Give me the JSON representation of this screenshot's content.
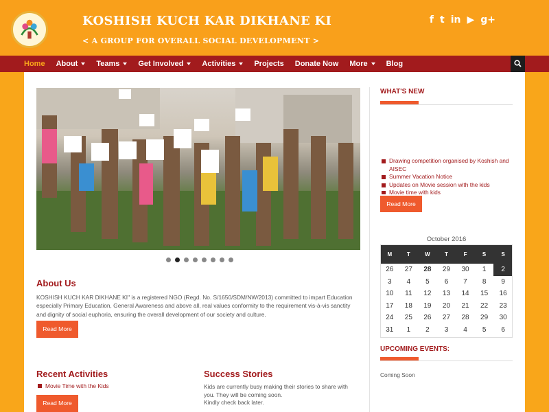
{
  "header": {
    "title": "KOSHISH KUCH KAR DIKHANE KI",
    "tagline": "< A GROUP FOR OVERALL SOCIAL DEVELOPMENT >",
    "logo_text": "KOSHISH KUCH KAR DIKHANE KI",
    "social": [
      {
        "icon": "facebook-icon",
        "glyph": "f"
      },
      {
        "icon": "twitter-icon",
        "glyph": "t"
      },
      {
        "icon": "linkedin-icon",
        "glyph": "in"
      },
      {
        "icon": "youtube-icon",
        "glyph": "▶"
      },
      {
        "icon": "googleplus-icon",
        "glyph": "g+"
      }
    ]
  },
  "nav": {
    "items": [
      {
        "label": "Home",
        "active": true,
        "dropdown": false
      },
      {
        "label": "About",
        "dropdown": true
      },
      {
        "label": "Teams",
        "dropdown": true
      },
      {
        "label": "Get Involved",
        "dropdown": true
      },
      {
        "label": "Activities",
        "dropdown": true
      },
      {
        "label": "Projects",
        "dropdown": false
      },
      {
        "label": "Donate Now",
        "dropdown": false
      },
      {
        "label": "More",
        "dropdown": true
      },
      {
        "label": "Blog",
        "dropdown": false
      }
    ]
  },
  "slider": {
    "dot_count": 8,
    "active_index": 1
  },
  "about": {
    "heading": "About Us",
    "text": "KOSHISH KUCH KAR DIKHANE KI\" is a registered NGO (Regd. No. S/1650/SDM/NW/2013) committed to impart Education especially Primary Education, General Awareness and above all, real values conformity to the requirement vis-à-vis sanctity and dignity of social euphoria, ensuring the overall development of our society and culture.",
    "button": "Read More"
  },
  "recent": {
    "heading": "Recent Activities",
    "items": [
      "Movie Time with the Kids"
    ],
    "button": "Read More"
  },
  "success": {
    "heading": "Success Stories",
    "lines": [
      "Kids are currently busy making their stories to share with",
      "you. They will be coming soon.",
      "Kindly check back later."
    ]
  },
  "whats_new": {
    "heading": "WHAT'S NEW",
    "items": [
      "Drawing competition organised by Koshish and AISEC",
      "Summer Vacation Notice",
      "Updates on Movie session with the kids",
      "Movie time with kids"
    ],
    "button": "Read More"
  },
  "calendar": {
    "caption": "October 2016",
    "headers": [
      "M",
      "T",
      "W",
      "T",
      "F",
      "S",
      "S"
    ],
    "weeks": [
      [
        "26",
        "27",
        "28",
        "29",
        "30",
        "1",
        "2"
      ],
      [
        "3",
        "4",
        "5",
        "6",
        "7",
        "8",
        "9"
      ],
      [
        "10",
        "11",
        "12",
        "13",
        "14",
        "15",
        "16"
      ],
      [
        "17",
        "18",
        "19",
        "20",
        "21",
        "22",
        "23"
      ],
      [
        "24",
        "25",
        "26",
        "27",
        "28",
        "29",
        "30"
      ],
      [
        "31",
        "1",
        "2",
        "3",
        "4",
        "5",
        "6"
      ]
    ],
    "today": "28",
    "selected": "2"
  },
  "events": {
    "heading": "UPCOMING EVENTS:",
    "text": "Coming Soon"
  },
  "colors": {
    "header_bg": "#f9a01b",
    "nav_bg": "#a21b1d",
    "accent": "#ef5a2d",
    "heading": "#a21b1d",
    "nav_active": "#f9a61a"
  }
}
